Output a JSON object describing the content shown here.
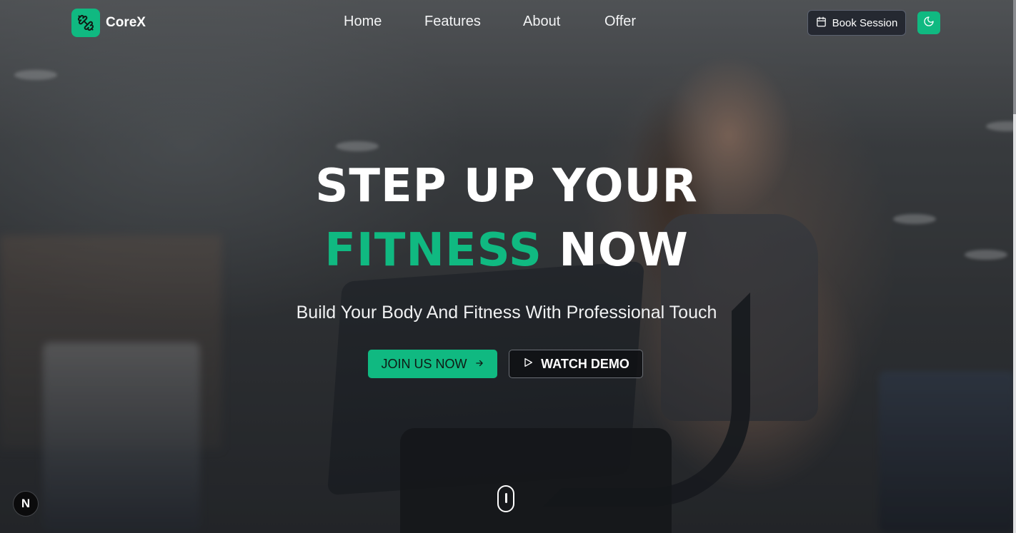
{
  "brand": {
    "name": "CoreX",
    "accent": "#10b981",
    "logo_icon": "dumbbell-icon"
  },
  "nav": {
    "links": [
      {
        "label": "Home"
      },
      {
        "label": "Features"
      },
      {
        "label": "About"
      },
      {
        "label": "Offer"
      }
    ],
    "book_button": {
      "label": "Book Session",
      "icon": "calendar-icon"
    },
    "theme_toggle": {
      "icon": "moon-icon"
    }
  },
  "hero": {
    "headline_line1": "STEP UP YOUR",
    "headline_accent": "FITNESS",
    "headline_rest": " NOW",
    "subtitle": "Build Your Body And Fitness With Professional Touch",
    "primary_cta": {
      "label": "JOIN US NOW",
      "icon": "arrow-right-icon"
    },
    "secondary_cta": {
      "label": "WATCH DEMO",
      "icon": "play-icon"
    },
    "scroll_indicator_icon": "mouse-icon"
  },
  "dev_badge": {
    "label": "N"
  }
}
